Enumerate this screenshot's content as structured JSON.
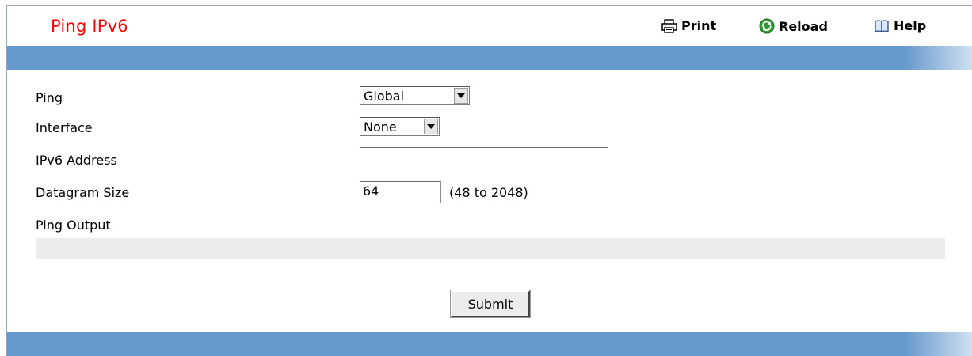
{
  "page": {
    "title": "Ping IPv6"
  },
  "toolbar": {
    "print_label": "Print",
    "reload_label": "Reload",
    "help_label": "Help",
    "icons": {
      "print": "printer-icon",
      "reload": "reload-icon",
      "help": "book-icon"
    }
  },
  "form": {
    "ping": {
      "label": "Ping",
      "value": "Global"
    },
    "interface": {
      "label": "Interface",
      "value": "None"
    },
    "ipv6_address": {
      "label": "IPv6 Address",
      "value": ""
    },
    "datagram_size": {
      "label": "Datagram Size",
      "value": "64",
      "range_hint": "(48 to 2048)"
    },
    "ping_output": {
      "label": "Ping Output",
      "value": ""
    },
    "submit_label": "Submit"
  },
  "colors": {
    "title": "#ff0000",
    "bar": "#6699cc",
    "output_bg": "#ececec"
  }
}
